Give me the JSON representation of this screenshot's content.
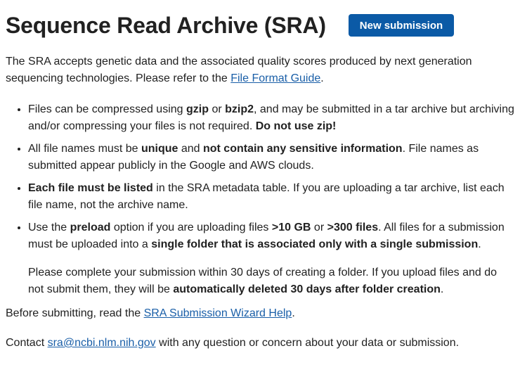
{
  "header": {
    "title": "Sequence Read Archive (SRA)",
    "button_label": "New submission"
  },
  "intro": {
    "text_before_link": "The SRA accepts genetic data and the associated quality scores produced by next generation sequencing technologies. Please refer to the ",
    "link": "File Format Guide",
    "text_after_link": "."
  },
  "bullets": [
    {
      "parts": [
        {
          "t": "Files can be compressed using "
        },
        {
          "t": "gzip",
          "b": true
        },
        {
          "t": " or "
        },
        {
          "t": "bzip2",
          "b": true
        },
        {
          "t": ", and may be submitted in a tar archive but archiving and/or compressing your files is not required. "
        },
        {
          "t": "Do not use zip!",
          "b": true
        }
      ]
    },
    {
      "parts": [
        {
          "t": "All file names must be "
        },
        {
          "t": "unique",
          "b": true
        },
        {
          "t": " and "
        },
        {
          "t": "not contain any sensitive information",
          "b": true
        },
        {
          "t": ". File names as submitted appear publicly in the Google and AWS clouds."
        }
      ]
    },
    {
      "parts": [
        {
          "t": "Each file must be listed",
          "b": true
        },
        {
          "t": " in the SRA metadata table. If you are uploading a tar archive, list each file name, not the archive name."
        }
      ]
    },
    {
      "parts": [
        {
          "t": "Use the "
        },
        {
          "t": "preload",
          "b": true
        },
        {
          "t": " option if you are uploading files "
        },
        {
          "t": ">10 GB",
          "b": true
        },
        {
          "t": " or "
        },
        {
          "t": ">300 files",
          "b": true
        },
        {
          "t": ". All files for a submission must be uploaded into a "
        },
        {
          "t": "single folder that is associated only with a single submission",
          "b": true
        },
        {
          "t": "."
        }
      ],
      "sub_parts": [
        {
          "t": "Please complete your submission within 30 days of creating a folder. If you upload files and do not submit them, they will be "
        },
        {
          "t": "automatically deleted 30 days after folder creation",
          "b": true
        },
        {
          "t": "."
        }
      ]
    }
  ],
  "before": {
    "text_before_link": "Before submitting, read the ",
    "link": "SRA Submission Wizard Help",
    "text_after_link": "."
  },
  "contact": {
    "text_before_link": "Contact ",
    "link": "sra@ncbi.nlm.nih.gov",
    "text_after_link": " with any question or concern about your data or submission."
  }
}
